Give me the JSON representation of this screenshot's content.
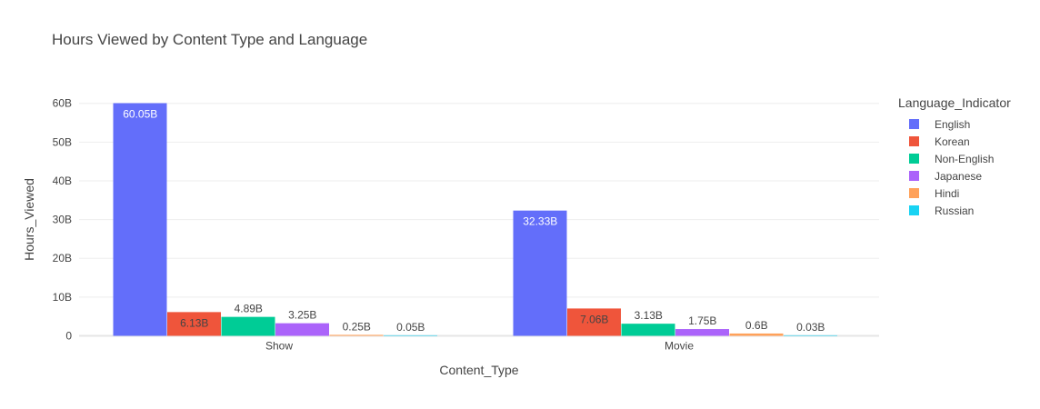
{
  "chart_data": {
    "type": "bar",
    "title": "Hours Viewed by Content Type and Language",
    "xlabel": "Content_Type",
    "ylabel": "Hours_Viewed",
    "categories": [
      "Show",
      "Movie"
    ],
    "ylim": [
      0,
      60.05
    ],
    "yticks": [
      0,
      10,
      20,
      30,
      40,
      50,
      60
    ],
    "ytick_labels": [
      "0",
      "10B",
      "20B",
      "30B",
      "40B",
      "50B",
      "60B"
    ],
    "grid": true,
    "legend_title": "Language_Indicator",
    "legend_position": "right",
    "series": [
      {
        "name": "English",
        "color": "#636efa",
        "values": [
          60.05,
          32.33
        ],
        "labels": [
          "60.05B",
          "32.33B"
        ]
      },
      {
        "name": "Korean",
        "color": "#ef553b",
        "values": [
          6.13,
          7.06
        ],
        "labels": [
          "6.13B",
          "7.06B"
        ]
      },
      {
        "name": "Non-English",
        "color": "#00cc96",
        "values": [
          4.89,
          3.13
        ],
        "labels": [
          "4.89B",
          "3.13B"
        ]
      },
      {
        "name": "Japanese",
        "color": "#ab63fa",
        "values": [
          3.25,
          1.75
        ],
        "labels": [
          "3.25B",
          "1.75B"
        ]
      },
      {
        "name": "Hindi",
        "color": "#ffa15a",
        "values": [
          0.25,
          0.6
        ],
        "labels": [
          "0.25B",
          "0.6B"
        ]
      },
      {
        "name": "Russian",
        "color": "#19d3f3",
        "values": [
          0.05,
          0.03
        ],
        "labels": [
          "0.05B",
          "0.03B"
        ]
      }
    ]
  }
}
